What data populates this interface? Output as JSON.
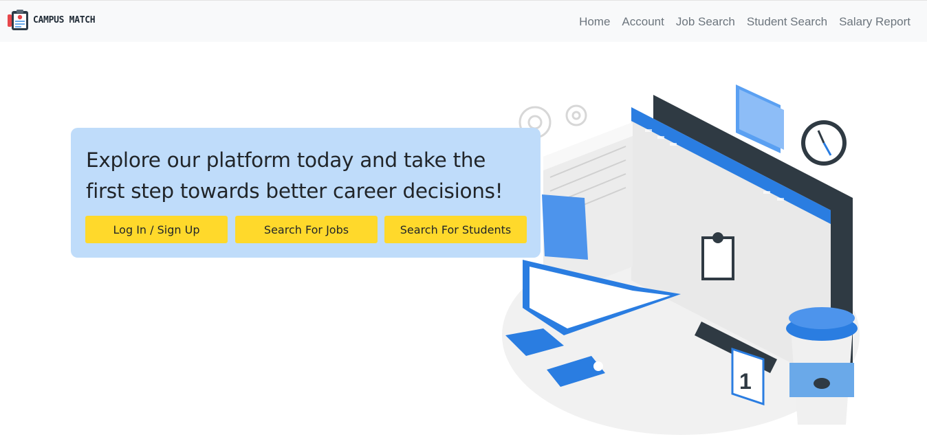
{
  "brand": {
    "name": "CAMPUS MATCH",
    "logo_icon": "resume-clipboard-icon"
  },
  "nav": {
    "links": [
      {
        "label": "Home"
      },
      {
        "label": "Account"
      },
      {
        "label": "Job Search"
      },
      {
        "label": "Student Search"
      },
      {
        "label": "Salary Report"
      }
    ]
  },
  "hero": {
    "headline": "Explore our platform today and take the first step towards better career decisions!",
    "buttons": {
      "login": "Log In / Sign Up",
      "jobs": "Search For Jobs",
      "students": "Search For Students"
    }
  },
  "colors": {
    "navbar_bg": "#f8f9fa",
    "card_bg": "#bfdcfa",
    "button_bg": "#ffd92b",
    "accent_blue": "#2a7de1"
  }
}
